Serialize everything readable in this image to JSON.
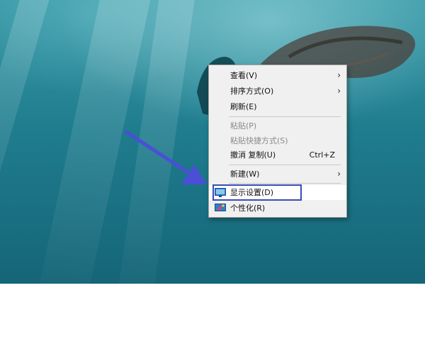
{
  "menu": {
    "items": [
      {
        "label": "查看(V)",
        "submenu": true
      },
      {
        "label": "排序方式(O)",
        "submenu": true
      },
      {
        "label": "刷新(E)"
      },
      {
        "label": "粘贴(P)",
        "disabled": true
      },
      {
        "label": "粘贴快捷方式(S)",
        "disabled": true
      },
      {
        "label": "撤消 复制(U)",
        "shortcut": "Ctrl+Z"
      },
      {
        "label": "新建(W)",
        "submenu": true
      },
      {
        "label": "显示设置(D)",
        "icon": "display-icon",
        "highlighted": true
      },
      {
        "label": "个性化(R)",
        "icon": "personalize-icon"
      }
    ]
  },
  "annotation": {
    "arrow_color": "#4a4fd6",
    "box_color": "#3b4bb8"
  }
}
